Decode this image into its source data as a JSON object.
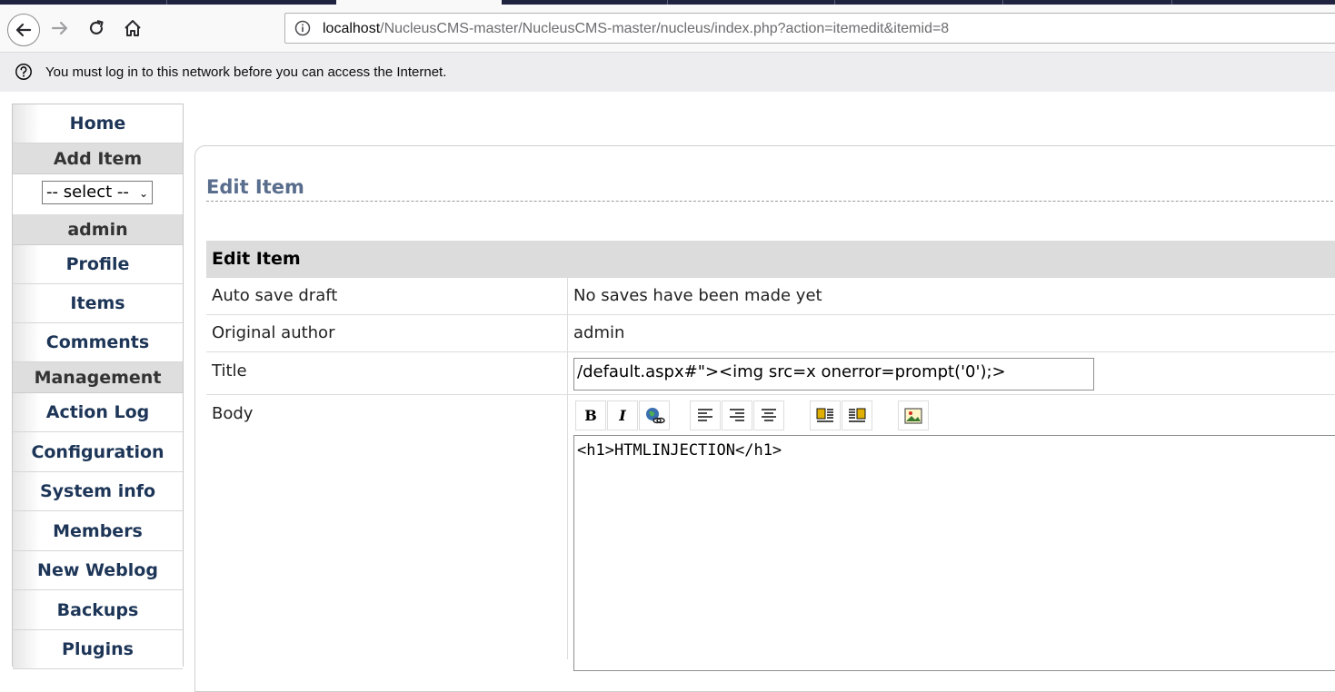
{
  "browser": {
    "url_host": "localhost",
    "url_path": "/NucleusCMS-master/NucleusCMS-master/nucleus/index.php?action=itemedit&itemid=8",
    "notification": "You must log in to this network before you can access the Internet."
  },
  "sidebar": {
    "home": "Home",
    "add_item_header": "Add Item",
    "blog_select": "-- select --",
    "user_header": "admin",
    "profile": "Profile",
    "items": "Items",
    "comments": "Comments",
    "management_header": "Management",
    "action_log": "Action Log",
    "configuration": "Configuration",
    "system_info": "System info",
    "members": "Members",
    "new_weblog": "New Weblog",
    "backups": "Backups",
    "plugins": "Plugins"
  },
  "page": {
    "title": "Edit Item",
    "table_header": "Edit Item",
    "rows": {
      "autosave_label": "Auto save draft",
      "autosave_value": "No saves have been made yet",
      "author_label": "Original author",
      "author_value": "admin",
      "title_label": "Title",
      "title_value": "/default.aspx#\"><img src=x onerror=prompt('0');>",
      "body_label": "Body",
      "body_value": "<h1>HTMLINJECTION</h1>"
    },
    "toolbar": {
      "bold": "B",
      "italic": "I"
    }
  }
}
